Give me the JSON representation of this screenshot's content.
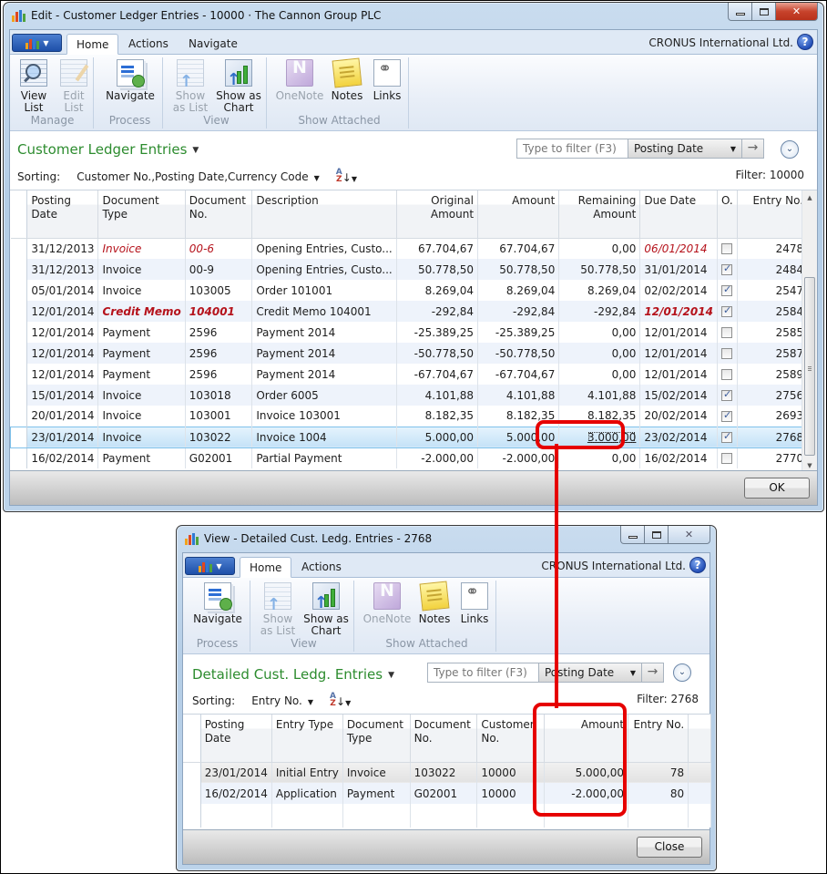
{
  "main_window": {
    "title": "Edit - Customer Ledger Entries - 10000 · The Cannon Group PLC",
    "tabs": [
      "Home",
      "Actions",
      "Navigate"
    ],
    "active_tab": "Home",
    "company": "CRONUS International Ltd.",
    "ribbon": {
      "groups": [
        {
          "label": "Manage",
          "buttons": [
            {
              "label": "View List",
              "icon": "view-list-icon",
              "enabled": true
            },
            {
              "label": "Edit List",
              "icon": "edit-list-icon",
              "enabled": false
            }
          ]
        },
        {
          "label": "Process",
          "buttons": [
            {
              "label": "Navigate",
              "icon": "navigate-icon",
              "enabled": true
            }
          ]
        },
        {
          "label": "View",
          "buttons": [
            {
              "label": "Show as List",
              "icon": "show-as-list-icon",
              "enabled": false
            },
            {
              "label": "Show as Chart",
              "icon": "show-as-chart-icon",
              "enabled": true
            }
          ]
        },
        {
          "label": "Show Attached",
          "buttons": [
            {
              "label": "OneNote",
              "icon": "onenote-icon",
              "enabled": false
            },
            {
              "label": "Notes",
              "icon": "notes-icon",
              "enabled": true
            },
            {
              "label": "Links",
              "icon": "links-icon",
              "enabled": true
            }
          ]
        }
      ]
    },
    "page_title": "Customer Ledger Entries",
    "filter_placeholder": "Type to filter (F3)",
    "filter_field": "Posting Date",
    "sorting_label": "Sorting:",
    "sorting_value": "Customer No.,Posting Date,Currency Code",
    "filter_text": "Filter: 10000",
    "columns": [
      "Posting Date",
      "Document Type",
      "Document No.",
      "Description",
      "Original Amount",
      "Amount",
      "Remaining Amount",
      "Due Date",
      "O.",
      "Entry No."
    ],
    "rows": [
      {
        "posting_date": "31/12/2013",
        "doc_type": "Invoice",
        "doc_no": "00-6",
        "description": "Opening Entries, Custo...",
        "original_amount": "67.704,67",
        "amount": "67.704,67",
        "remaining_amount": "0,00",
        "due_date": "06/01/2014",
        "open": false,
        "entry_no": "2478",
        "style": "overdue-italic"
      },
      {
        "posting_date": "31/12/2013",
        "doc_type": "Invoice",
        "doc_no": "00-9",
        "description": "Opening Entries, Custo...",
        "original_amount": "50.778,50",
        "amount": "50.778,50",
        "remaining_amount": "50.778,50",
        "due_date": "31/01/2014",
        "open": true,
        "entry_no": "2484",
        "style": ""
      },
      {
        "posting_date": "05/01/2014",
        "doc_type": "Invoice",
        "doc_no": "103005",
        "description": "Order 101001",
        "original_amount": "8.269,04",
        "amount": "8.269,04",
        "remaining_amount": "8.269,04",
        "due_date": "02/02/2014",
        "open": true,
        "entry_no": "2547",
        "style": ""
      },
      {
        "posting_date": "12/01/2014",
        "doc_type": "Credit Memo",
        "doc_no": "104001",
        "description": "Credit Memo 104001",
        "original_amount": "-292,84",
        "amount": "-292,84",
        "remaining_amount": "-292,84",
        "due_date": "12/01/2014",
        "open": true,
        "entry_no": "2584",
        "style": "overdue-bold"
      },
      {
        "posting_date": "12/01/2014",
        "doc_type": "Payment",
        "doc_no": "2596",
        "description": "Payment 2014",
        "original_amount": "-25.389,25",
        "amount": "-25.389,25",
        "remaining_amount": "0,00",
        "due_date": "12/01/2014",
        "open": false,
        "entry_no": "2585",
        "style": ""
      },
      {
        "posting_date": "12/01/2014",
        "doc_type": "Payment",
        "doc_no": "2596",
        "description": "Payment 2014",
        "original_amount": "-50.778,50",
        "amount": "-50.778,50",
        "remaining_amount": "0,00",
        "due_date": "12/01/2014",
        "open": false,
        "entry_no": "2587",
        "style": ""
      },
      {
        "posting_date": "12/01/2014",
        "doc_type": "Payment",
        "doc_no": "2596",
        "description": "Payment 2014",
        "original_amount": "-67.704,67",
        "amount": "-67.704,67",
        "remaining_amount": "0,00",
        "due_date": "12/01/2014",
        "open": false,
        "entry_no": "2589",
        "style": ""
      },
      {
        "posting_date": "15/01/2014",
        "doc_type": "Invoice",
        "doc_no": "103018",
        "description": "Order 6005",
        "original_amount": "4.101,88",
        "amount": "4.101,88",
        "remaining_amount": "4.101,88",
        "due_date": "15/02/2014",
        "open": true,
        "entry_no": "2756",
        "style": ""
      },
      {
        "posting_date": "20/01/2014",
        "doc_type": "Invoice",
        "doc_no": "103001",
        "description": "Invoice 103001",
        "original_amount": "8.182,35",
        "amount": "8.182,35",
        "remaining_amount": "8.182,35",
        "due_date": "20/02/2014",
        "open": true,
        "entry_no": "2693",
        "style": ""
      },
      {
        "posting_date": "23/01/2014",
        "doc_type": "Invoice",
        "doc_no": "103022",
        "description": "Invoice 1004",
        "original_amount": "5.000,00",
        "amount": "5.000,00",
        "remaining_amount": "3.000,00",
        "due_date": "23/02/2014",
        "open": true,
        "entry_no": "2768",
        "style": "selected"
      },
      {
        "posting_date": "16/02/2014",
        "doc_type": "Payment",
        "doc_no": "G02001",
        "description": "Partial Payment",
        "original_amount": "-2.000,00",
        "amount": "-2.000,00",
        "remaining_amount": "0,00",
        "due_date": "16/02/2014",
        "open": false,
        "entry_no": "2770",
        "style": ""
      }
    ],
    "ok_label": "OK"
  },
  "detail_window": {
    "title": "View - Detailed Cust. Ledg. Entries - 2768",
    "tabs": [
      "Home",
      "Actions"
    ],
    "active_tab": "Home",
    "company": "CRONUS International Ltd.",
    "ribbon": {
      "groups": [
        {
          "label": "Process",
          "buttons": [
            {
              "label": "Navigate",
              "icon": "navigate-icon",
              "enabled": true
            }
          ]
        },
        {
          "label": "View",
          "buttons": [
            {
              "label": "Show as List",
              "icon": "show-as-list-icon",
              "enabled": false
            },
            {
              "label": "Show as Chart",
              "icon": "show-as-chart-icon",
              "enabled": true
            }
          ]
        },
        {
          "label": "Show Attached",
          "buttons": [
            {
              "label": "OneNote",
              "icon": "onenote-icon",
              "enabled": false
            },
            {
              "label": "Notes",
              "icon": "notes-icon",
              "enabled": true
            },
            {
              "label": "Links",
              "icon": "links-icon",
              "enabled": true
            }
          ]
        }
      ]
    },
    "page_title": "Detailed Cust. Ledg. Entries",
    "filter_placeholder": "Type to filter (F3)",
    "filter_field": "Posting Date",
    "sorting_label": "Sorting:",
    "sorting_value": "Entry No.",
    "filter_text": "Filter: 2768",
    "columns": [
      "Posting Date",
      "Entry Type",
      "Document Type",
      "Document No.",
      "Customer No.",
      "Amount",
      "Entry No."
    ],
    "rows": [
      {
        "posting_date": "23/01/2014",
        "entry_type": "Initial Entry",
        "doc_type": "Invoice",
        "doc_no": "103022",
        "customer_no": "10000",
        "amount": "5.000,00",
        "entry_no": "78"
      },
      {
        "posting_date": "16/02/2014",
        "entry_type": "Application",
        "doc_type": "Payment",
        "doc_no": "G02001",
        "customer_no": "10000",
        "amount": "-2.000,00",
        "entry_no": "80"
      }
    ],
    "close_label": "Close"
  },
  "colors": {
    "page_title_green": "#2d8c2f",
    "overdue_red": "#b5121b",
    "annotation_red": "#e60000",
    "selection_blue": "#c4e2f7"
  }
}
